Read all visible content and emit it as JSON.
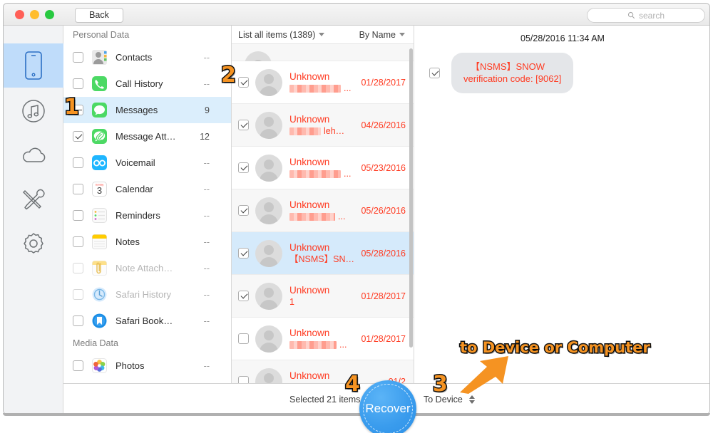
{
  "window": {
    "traffic_lights": [
      "close",
      "minimize",
      "zoom"
    ],
    "back_label": "Back"
  },
  "search": {
    "placeholder": "search",
    "icon": "search-icon"
  },
  "rail": {
    "items": [
      {
        "name": "device",
        "icon": "phone-icon",
        "active": true
      },
      {
        "name": "music",
        "icon": "music-note-circle-icon",
        "active": false
      },
      {
        "name": "cloud",
        "icon": "cloud-icon",
        "active": false
      },
      {
        "name": "toolkit",
        "icon": "wrench-screwdriver-icon",
        "active": false
      },
      {
        "name": "settings",
        "icon": "gear-icon",
        "active": false
      }
    ]
  },
  "sidebar": {
    "groups": [
      {
        "title": "Personal Data",
        "items": [
          {
            "label": "Contacts",
            "count": "--",
            "icon": "contacts-icon",
            "state": "unchecked",
            "muted": false,
            "selected": false
          },
          {
            "label": "Call History",
            "count": "--",
            "icon": "phone-green-icon",
            "state": "unchecked",
            "muted": false,
            "selected": false
          },
          {
            "label": "Messages",
            "count": "9",
            "icon": "messages-icon",
            "state": "dash",
            "muted": false,
            "selected": true
          },
          {
            "label": "Message Att…",
            "count": "12",
            "icon": "message-attach-icon",
            "state": "checked",
            "muted": false,
            "selected": false
          },
          {
            "label": "Voicemail",
            "count": "--",
            "icon": "voicemail-icon",
            "state": "unchecked",
            "muted": false,
            "selected": false
          },
          {
            "label": "Calendar",
            "count": "--",
            "icon": "calendar-icon",
            "state": "unchecked",
            "muted": false,
            "selected": false
          },
          {
            "label": "Reminders",
            "count": "--",
            "icon": "reminders-icon",
            "state": "unchecked",
            "muted": false,
            "selected": false
          },
          {
            "label": "Notes",
            "count": "--",
            "icon": "notes-icon",
            "state": "unchecked",
            "muted": false,
            "selected": false
          },
          {
            "label": "Note Attach…",
            "count": "--",
            "icon": "note-attach-icon",
            "state": "unchecked",
            "muted": true,
            "selected": false
          },
          {
            "label": "Safari History",
            "count": "--",
            "icon": "safari-history-icon",
            "state": "unchecked",
            "muted": true,
            "selected": false
          },
          {
            "label": "Safari Book…",
            "count": "--",
            "icon": "safari-bookmark-icon",
            "state": "unchecked",
            "muted": false,
            "selected": false
          }
        ]
      },
      {
        "title": "Media Data",
        "items": [
          {
            "label": "Photos",
            "count": "--",
            "icon": "photos-icon",
            "state": "unchecked",
            "muted": false,
            "selected": false
          }
        ]
      }
    ]
  },
  "list": {
    "header": {
      "filter_label": "List all items (1389)",
      "sort_label": "By Name"
    },
    "rows": [
      {
        "name": "Unknown",
        "preview": "",
        "preview_redacted": true,
        "redact_width": 72,
        "ellipsis": true,
        "date": "01/28/2017",
        "state": "checked",
        "selected": false
      },
      {
        "name": "Unknown",
        "preview": "leh…",
        "preview_redacted": true,
        "redact_width": 44,
        "ellipsis": false,
        "date": "04/26/2016",
        "state": "checked",
        "selected": false
      },
      {
        "name": "Unknown",
        "preview": "",
        "preview_redacted": true,
        "redact_width": 72,
        "ellipsis": true,
        "date": "05/23/2016",
        "state": "checked",
        "selected": false
      },
      {
        "name": "Unknown",
        "preview": "",
        "preview_redacted": true,
        "redact_width": 64,
        "ellipsis": true,
        "date": "05/26/2016",
        "state": "checked",
        "selected": false
      },
      {
        "name": "Unknown",
        "preview": "【NSMS】SN…",
        "preview_redacted": false,
        "redact_width": 0,
        "ellipsis": false,
        "date": "05/28/2016",
        "state": "checked",
        "selected": true
      },
      {
        "name": "Unknown",
        "preview": "1",
        "preview_redacted": false,
        "redact_width": 0,
        "ellipsis": false,
        "date": "01/28/2017",
        "state": "checked",
        "selected": false
      },
      {
        "name": "Unknown",
        "preview": "",
        "preview_redacted": true,
        "redact_width": 66,
        "ellipsis": true,
        "date": "01/28/2017",
        "state": "unchecked",
        "selected": false
      },
      {
        "name": "Unknown",
        "preview": "",
        "preview_redacted": true,
        "redact_width": 60,
        "ellipsis": true,
        "date": "01/2",
        "state": "unchecked",
        "selected": false
      }
    ]
  },
  "detail": {
    "timestamp": "05/28/2016 11:34 AM",
    "message": {
      "line1": "【NSMS】SNOW",
      "line2": "verification code: [9062]",
      "state": "checked"
    }
  },
  "bottom": {
    "selected_text": "Selected 21 items",
    "recover_label": "Recover",
    "destination_label": "To Device"
  },
  "annotations": {
    "step1": "1",
    "step2": "2",
    "step3": "3",
    "step4": "4",
    "callout": "to Device or Computer",
    "arrow": "arrow-up-right-icon"
  },
  "colors": {
    "accent_blue": "#3a9ced",
    "annotation_orange": "#f59322",
    "list_red": "#ff3b22",
    "selected_row": "#d5eafb"
  }
}
